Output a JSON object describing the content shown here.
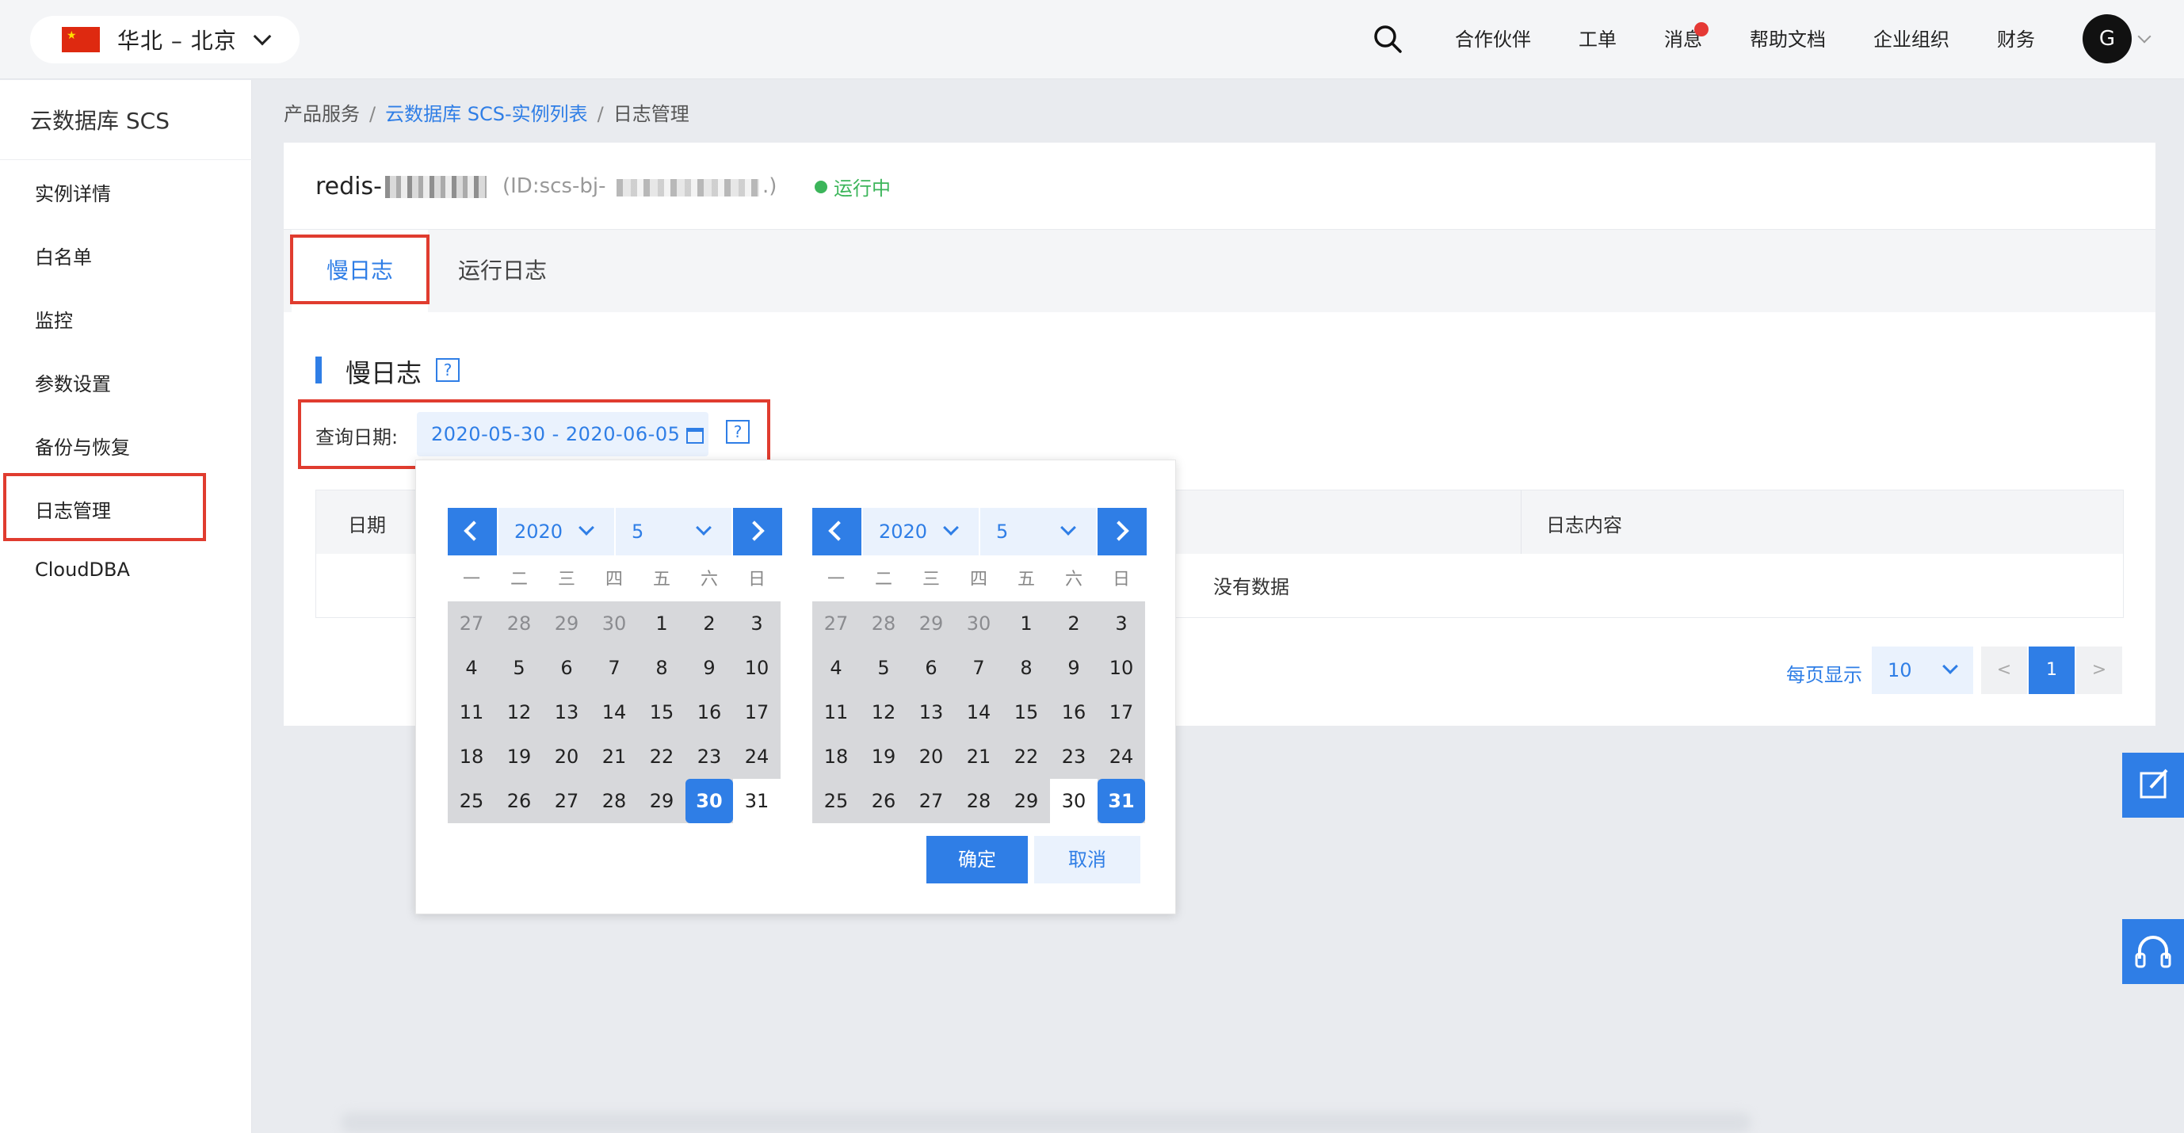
{
  "topbar": {
    "region": "华北 – 北京",
    "nav": [
      "合作伙伴",
      "工单",
      "消息",
      "帮助文档",
      "企业组织",
      "财务"
    ],
    "avatar": "G",
    "colors": {
      "accent": "#2f7ee6",
      "badge": "#e53935"
    }
  },
  "sidebar": {
    "title": "云数据库 SCS",
    "items": [
      "实例详情",
      "白名单",
      "监控",
      "参数设置",
      "备份与恢复",
      "日志管理",
      "CloudDBA"
    ]
  },
  "breadcrumb": {
    "a": "产品服务",
    "b": "云数据库 SCS-实例列表",
    "c": "日志管理",
    "sep": "/"
  },
  "instance": {
    "name": "redis-",
    "id_prefix": "(ID:scs-bj-",
    "id_suffix": ".)",
    "status": "运行中"
  },
  "tabs": [
    "慢日志",
    "运行日志"
  ],
  "section": {
    "title": "慢日志",
    "help": "?"
  },
  "query": {
    "label": "查询日期:",
    "range": "2020-05-30 - 2020-06-05"
  },
  "table": {
    "columns": [
      "日期",
      "日志内容"
    ],
    "empty": "没有数据"
  },
  "pager": {
    "label": "每页显示",
    "page_size": "10",
    "prev": "<",
    "current": "1",
    "next": ">"
  },
  "datepicker": {
    "weekdays": [
      "一",
      "二",
      "三",
      "四",
      "五",
      "六",
      "日"
    ],
    "left": {
      "year": "2020",
      "month": "5",
      "selected": "30"
    },
    "right": {
      "year": "2020",
      "month": "5",
      "selected": "31"
    },
    "ok": "确定",
    "cancel": "取消"
  }
}
